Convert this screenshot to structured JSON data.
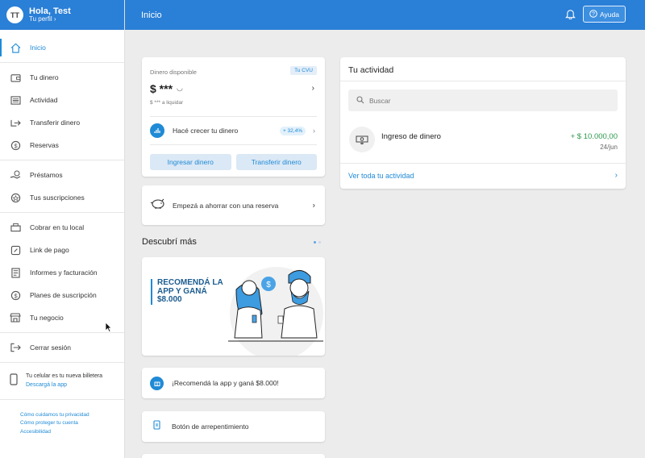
{
  "colors": {
    "brand": "#2a7fd6",
    "accent": "#1f8ad6",
    "positive": "#2e9a4d"
  },
  "user": {
    "initials": "TT",
    "greeting": "Hola, Test",
    "profile_link": "Tu perfil"
  },
  "sidebar": {
    "items": [
      {
        "label": "Inicio",
        "icon": "home-icon",
        "active": true
      },
      {
        "label": "Tu dinero",
        "icon": "wallet-icon"
      },
      {
        "label": "Actividad",
        "icon": "list-icon"
      },
      {
        "label": "Transferir dinero",
        "icon": "transfer-icon"
      },
      {
        "label": "Reservas",
        "icon": "savings-icon"
      },
      {
        "label": "Préstamos",
        "icon": "loan-icon"
      },
      {
        "label": "Tus suscripciones",
        "icon": "star-icon"
      },
      {
        "label": "Cobrar en tu local",
        "icon": "register-icon"
      },
      {
        "label": "Link de pago",
        "icon": "link-icon"
      },
      {
        "label": "Informes y facturación",
        "icon": "report-icon"
      },
      {
        "label": "Planes de suscripción",
        "icon": "dollar-icon"
      },
      {
        "label": "Tu negocio",
        "icon": "store-icon"
      },
      {
        "label": "Cerrar sesión",
        "icon": "logout-icon"
      }
    ],
    "wallet_promo": {
      "text": "Tu celular es tu nueva billetera",
      "link": "Descargá la app"
    },
    "footer_links": [
      "Cómo cuidamos tu privacidad",
      "Cómo proteger tu cuenta",
      "Accesibilidad"
    ]
  },
  "topbar": {
    "title": "Inicio",
    "help_label": "Ayuda"
  },
  "balance": {
    "label": "Dinero disponible",
    "cvu_badge": "Tu CVU",
    "amount": "$ ***",
    "to_settle": "$ *** a liquidar",
    "grow_text": "Hacé crecer tu dinero",
    "grow_rate": "+ 32,4%",
    "deposit_button": "Ingresar dinero",
    "transfer_button": "Transferir dinero"
  },
  "reserve_card": {
    "text": "Empezá a ahorrar con una reserva"
  },
  "discover": {
    "title": "Descubrí más",
    "promo_lines": [
      "RECOMENDÁ LA",
      "APP Y GANÁ",
      "$8.000"
    ]
  },
  "recommend_card": {
    "text": "¡Recomendá la app y ganá $8.000!"
  },
  "regret_card": {
    "text": "Botón de arrepentimiento"
  },
  "activity": {
    "title": "Tu actividad",
    "search_placeholder": "Buscar",
    "transaction": {
      "title": "Ingreso de dinero",
      "amount": "+ $ 10.000,00",
      "date": "24/jun"
    },
    "see_all": "Ver toda tu actividad"
  }
}
